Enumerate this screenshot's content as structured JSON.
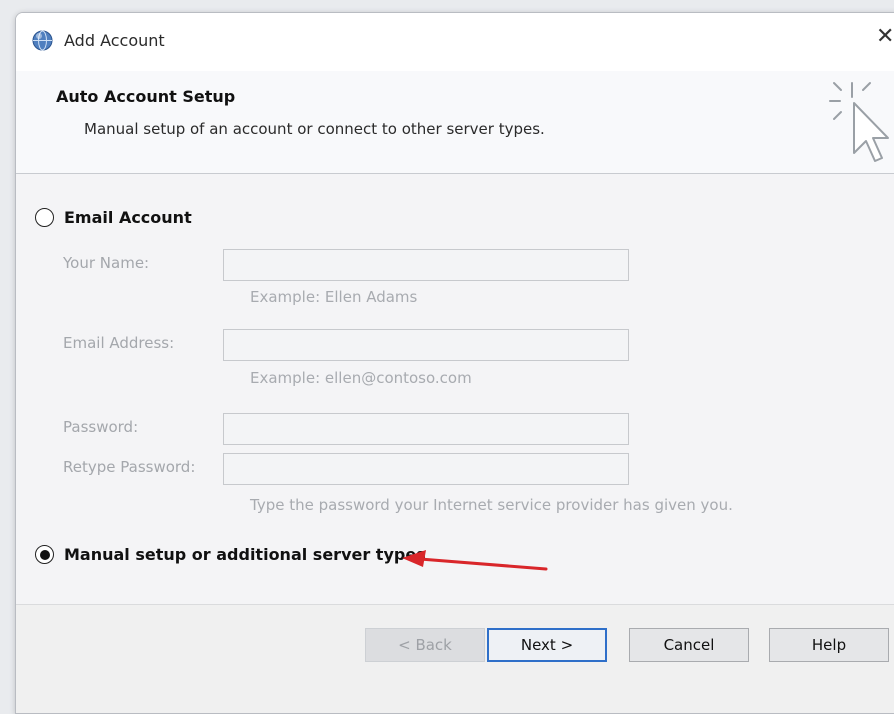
{
  "window": {
    "title": "Add Account",
    "close_glyph": "✕"
  },
  "header": {
    "title": "Auto Account Setup",
    "subtitle": "Manual setup of an account or connect to other server types.",
    "icon": "cursor-sparkle-icon"
  },
  "options": {
    "email_account": {
      "label": "Email Account",
      "selected": false
    },
    "manual_setup": {
      "label": "Manual setup or additional server types",
      "selected": true
    }
  },
  "fields": {
    "your_name": {
      "label": "Your Name:",
      "value": "",
      "hint": "Example: Ellen Adams"
    },
    "email_address": {
      "label": "Email Address:",
      "value": "",
      "hint": "Example: ellen@contoso.com"
    },
    "password": {
      "label": "Password:",
      "value": ""
    },
    "retype_password": {
      "label": "Retype Password:",
      "value": ""
    },
    "password_hint": "Type the password your Internet service provider has given you."
  },
  "annotation": {
    "color": "#d9262a"
  },
  "buttons": {
    "back": "< Back",
    "next": "Next >",
    "cancel": "Cancel",
    "help": "Help"
  },
  "colors": {
    "accent": "#2f6fc9",
    "disabled_text": "#a4a7ac"
  }
}
